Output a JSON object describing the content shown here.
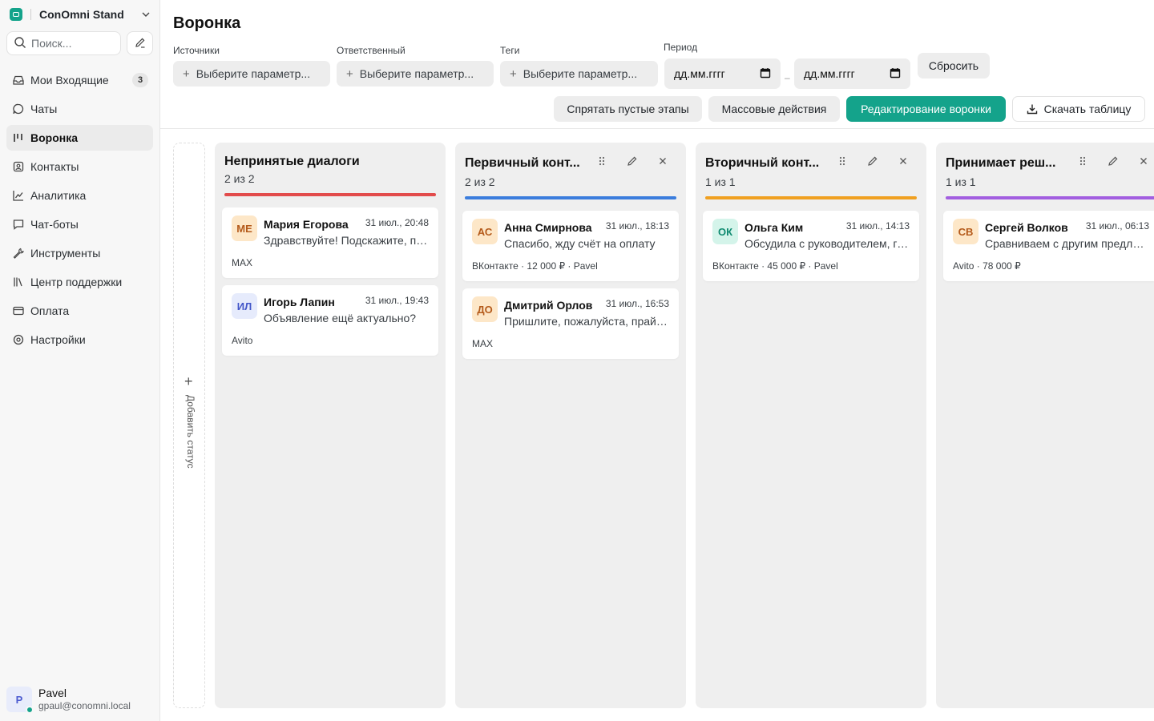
{
  "sidebar": {
    "workspace": "ConOmni Stand",
    "search_placeholder": "Поиск...",
    "nav": [
      {
        "label": "Мои Входящие",
        "badge": "3"
      },
      {
        "label": "Чаты"
      },
      {
        "label": "Воронка"
      },
      {
        "label": "Контакты"
      },
      {
        "label": "Аналитика"
      },
      {
        "label": "Чат-боты"
      },
      {
        "label": "Инструменты"
      },
      {
        "label": "Центр поддержки"
      },
      {
        "label": "Оплата"
      },
      {
        "label": "Настройки"
      }
    ],
    "user": {
      "initial": "P",
      "name": "Pavel",
      "email": "gpaul@conomni.local"
    }
  },
  "header": {
    "title": "Воронка",
    "filters": {
      "sources": {
        "label": "Источники",
        "placeholder": "Выберите параметр..."
      },
      "owner": {
        "label": "Ответственный",
        "placeholder": "Выберите параметр..."
      },
      "tags": {
        "label": "Теги",
        "placeholder": "Выберите параметр..."
      },
      "period": {
        "label": "Период",
        "from": "дд.мм.гггг",
        "to": "дд.мм.гггг",
        "dash": "–"
      }
    },
    "reset": "Сбросить",
    "actions": {
      "hide_empty": "Спрятать пустые этапы",
      "bulk": "Массовые действия",
      "edit": "Редактирование воронки",
      "download": "Скачать таблицу"
    }
  },
  "add_status": "Добавить статус",
  "colors": {
    "accent": "#14a38b",
    "stage1": "#e24b4b",
    "stage2": "#3b7ddd",
    "stage3": "#f0a020",
    "stage4": "#a25ee0"
  },
  "columns": [
    {
      "title": "Непринятые диалоги",
      "count": "2 из 2",
      "cards": [
        {
          "initials": "МЕ",
          "name": "Мария Егорова",
          "time": "31 июл., 20:48",
          "message": "Здравствуйте! Подскажите, пожалуйста",
          "meta": "MAX"
        },
        {
          "initials": "ИЛ",
          "name": "Игорь Лапин",
          "time": "31 июл., 19:43",
          "message": "Объявление ещё актуально?",
          "meta": "Avito"
        }
      ]
    },
    {
      "title": "Первичный конт...",
      "count": "2 из 2",
      "cards": [
        {
          "initials": "АС",
          "name": "Анна Смирнова",
          "time": "31 июл., 18:13",
          "message": "Спасибо, жду счёт на оплату",
          "meta": "ВКонтакте · 12 000 ₽ · Pavel"
        },
        {
          "initials": "ДО",
          "name": "Дмитрий Орлов",
          "time": "31 июл., 16:53",
          "message": "Пришлите, пожалуйста, прайс-лист",
          "meta": "MAX"
        }
      ]
    },
    {
      "title": "Вторичный конт...",
      "count": "1 из 1",
      "cards": [
        {
          "initials": "ОК",
          "name": "Ольга Ким",
          "time": "31 июл., 14:13",
          "message": "Обсудила с руководителем, готовы",
          "meta": "ВКонтакте · 45 000 ₽ · Pavel"
        }
      ]
    },
    {
      "title": "Принимает реш...",
      "count": "1 из 1",
      "cards": [
        {
          "initials": "СВ",
          "name": "Сергей Волков",
          "time": "31 июл., 06:13",
          "message": "Сравниваем с другим предложением",
          "meta": "Avito · 78 000 ₽"
        }
      ]
    }
  ]
}
